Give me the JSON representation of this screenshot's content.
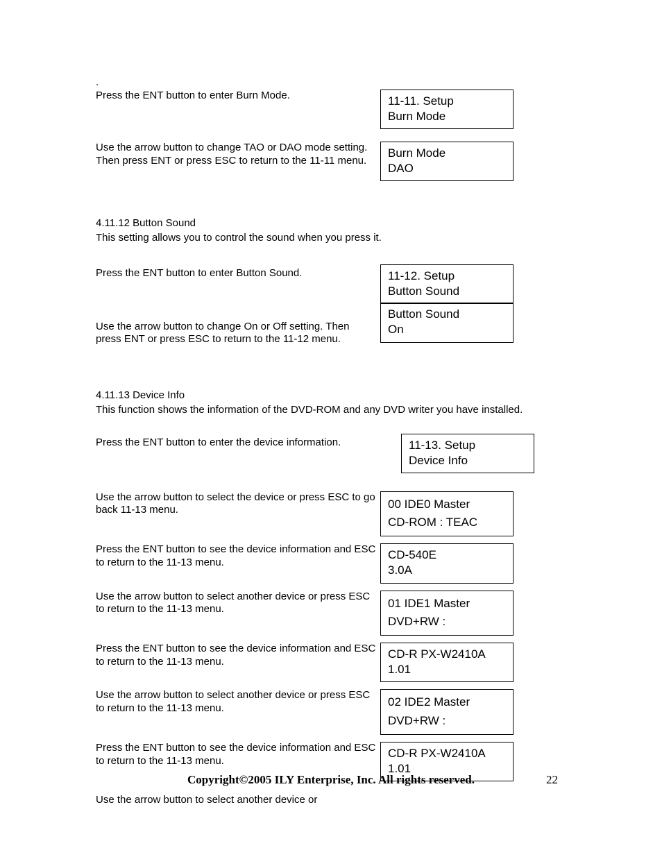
{
  "dot": ".",
  "s1": {
    "instr1": "Press the ENT button to enter Burn Mode.",
    "box1_l1": "11-11. Setup",
    "box1_l2": "Burn Mode",
    "instr2": "Use the arrow button to change TAO or DAO mode setting. Then press ENT or press ESC to return to the 11-11 menu.",
    "box2_l1": "Burn Mode",
    "box2_l2": "DAO"
  },
  "s2": {
    "head": "4.11.12 Button Sound",
    "desc": "This setting allows you to control the sound when you press it.",
    "instr1": "Press the ENT button to enter Button Sound.",
    "box1_l1": "11-12. Setup",
    "box1_l2": "Button Sound",
    "instr2": "Use the arrow button to change On or Off setting. Then press ENT or press ESC to return to the 11-12 menu.",
    "box2_l1": "Button Sound",
    "box2_l2": "On"
  },
  "s3": {
    "head": "4.11.13 Device Info",
    "desc": "This function shows the information of the DVD-ROM and any DVD writer you have installed.",
    "instr1": "Press the ENT button to enter the device information.",
    "box1_l1": "11-13. Setup",
    "box1_l2": "Device Info",
    "instr2": "Use the arrow button to select the device or press ESC to go back 11-13 menu.",
    "box2_l1": "00 IDE0 Master",
    "box2_l2": "CD-ROM : TEAC",
    "instr3": "Press the ENT button to see the device information and ESC to return to the 11-13 menu.",
    "box3_l1": "CD-540E",
    "box3_l2": "3.0A",
    "instr4": "Use the arrow button to select another device or press ESC to return to the 11-13 menu.",
    "box4_l1": "01 IDE1 Master",
    "box4_l2": "DVD+RW :",
    "instr5": "Press the ENT button to see the device information and ESC to return to the 11-13 menu.",
    "box5_l1": "CD-R PX-W2410A",
    "box5_l2": "1.01",
    "instr6": "Use the arrow button to select another device or press ESC to return to the 11-13 menu.",
    "box6_l1": "02 IDE2 Master",
    "box6_l2": "DVD+RW :",
    "instr7": "Press the ENT button to see the device information and ESC to return to the 11-13 menu.",
    "box7_l1": "CD-R PX-W2410A",
    "box7_l2": "1.01",
    "instr8": "Use the arrow button to select another device or"
  },
  "footer": {
    "copyright": "Copyright©2005 ILY Enterprise, Inc.  All rights reserved.",
    "page": "22"
  }
}
